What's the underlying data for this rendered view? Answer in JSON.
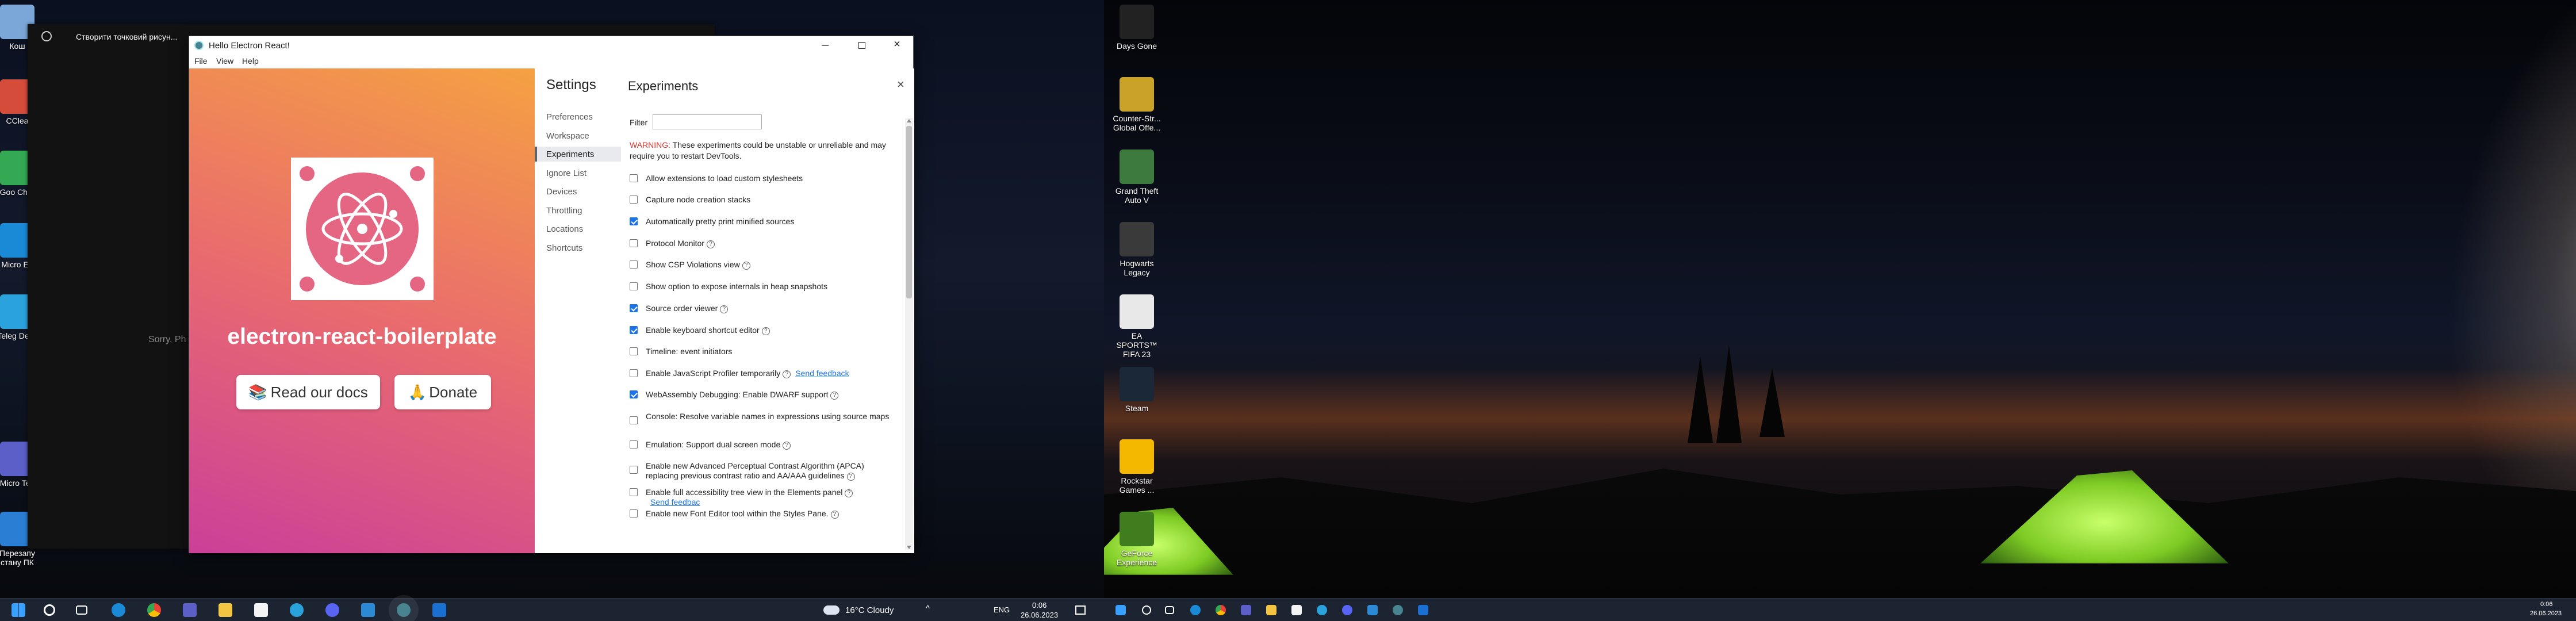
{
  "left_desktop": {
    "icons": [
      {
        "label": "Кош",
        "color": "#7aa7d8"
      },
      {
        "label": "CClea",
        "color": "#d64c3b"
      },
      {
        "label": "Goo Chro",
        "color": "#34a853"
      },
      {
        "label": "Micro Ed",
        "color": "#1b8ad6"
      },
      {
        "label": "Teleg Desk",
        "color": "#2aa3dd"
      },
      {
        "label": "Micro Tea",
        "color": "#5b5fc7"
      },
      {
        "label": "Перезапу стану ПК",
        "color": "#2a7fd4"
      }
    ]
  },
  "black_window": {
    "title": "Створити точковий рисун...",
    "body_text": "Sorry, Ph"
  },
  "app_window": {
    "title": "Hello Electron React!",
    "menu": [
      "File",
      "View",
      "Help"
    ],
    "hero": {
      "heading": "electron-react-boilerplate",
      "docs_button": "Read our docs",
      "docs_emoji": "📚",
      "donate_button": "Donate",
      "donate_emoji": "🙏"
    },
    "settings": {
      "heading": "Settings",
      "nav": [
        "Preferences",
        "Workspace",
        "Experiments",
        "Ignore List",
        "Devices",
        "Throttling",
        "Locations",
        "Shortcuts"
      ],
      "active_nav": "Experiments",
      "panel_title": "Experiments",
      "filter_label": "Filter",
      "filter_value": "",
      "warning_label": "WARNING:",
      "warning_text": " These experiments could be unstable or unreliable and may require you to restart DevTools.",
      "experiments": [
        {
          "label": "Allow extensions to load custom stylesheets",
          "checked": false,
          "help": false,
          "link": ""
        },
        {
          "label": "Capture node creation stacks",
          "checked": false,
          "help": false,
          "link": ""
        },
        {
          "label": "Automatically pretty print minified sources",
          "checked": true,
          "help": false,
          "link": ""
        },
        {
          "label": "Protocol Monitor",
          "checked": false,
          "help": true,
          "link": ""
        },
        {
          "label": "Show CSP Violations view",
          "checked": false,
          "help": true,
          "link": ""
        },
        {
          "label": "Show option to expose internals in heap snapshots",
          "checked": false,
          "help": false,
          "link": ""
        },
        {
          "label": "Source order viewer",
          "checked": true,
          "help": true,
          "link": ""
        },
        {
          "label": "Enable keyboard shortcut editor",
          "checked": true,
          "help": true,
          "link": ""
        },
        {
          "label": "Timeline: event initiators",
          "checked": false,
          "help": false,
          "link": ""
        },
        {
          "label": "Enable JavaScript Profiler temporarily",
          "checked": false,
          "help": true,
          "link": "Send feedback"
        },
        {
          "label": "WebAssembly Debugging: Enable DWARF support",
          "checked": true,
          "help": true,
          "link": ""
        },
        {
          "label": "Console: Resolve variable names in expressions using source maps",
          "checked": false,
          "help": false,
          "link": ""
        },
        {
          "label": "Emulation: Support dual screen mode",
          "checked": false,
          "help": true,
          "link": ""
        },
        {
          "label": "Enable new Advanced Perceptual Contrast Algorithm (APCA) replacing previous contrast ratio and AA/AAA guidelines",
          "checked": false,
          "help": true,
          "link": ""
        },
        {
          "label": "Enable full accessibility tree view in the Elements panel",
          "checked": false,
          "help": true,
          "link": "Send feedbac"
        },
        {
          "label": "Enable new Font Editor tool within the Styles Pane.",
          "checked": false,
          "help": true,
          "link": ""
        }
      ]
    }
  },
  "right_desktop": {
    "icons": [
      {
        "label": "Days Gone",
        "color": "#222222"
      },
      {
        "label": "Counter-Str... Global Offe...",
        "color": "#c9a227"
      },
      {
        "label": "Grand Theft Auto V",
        "color": "#3d7a3d"
      },
      {
        "label": "Hogwarts Legacy",
        "color": "#3a3a3a"
      },
      {
        "label": "EA SPORTS™ FIFA 23",
        "color": "#e8e8e8"
      },
      {
        "label": "Steam",
        "color": "#1b2838"
      },
      {
        "label": "Rockstar Games ...",
        "color": "#f5b800"
      },
      {
        "label": "GeForce Experience",
        "color": "#3f7d1e"
      }
    ]
  },
  "taskbar_left": {
    "weather": "16°C  Cloudy",
    "language": "ENG",
    "time": "0:06",
    "date": "26.06.2023"
  },
  "taskbar_right": {
    "time": "0:06",
    "date": "26.06.2023"
  }
}
